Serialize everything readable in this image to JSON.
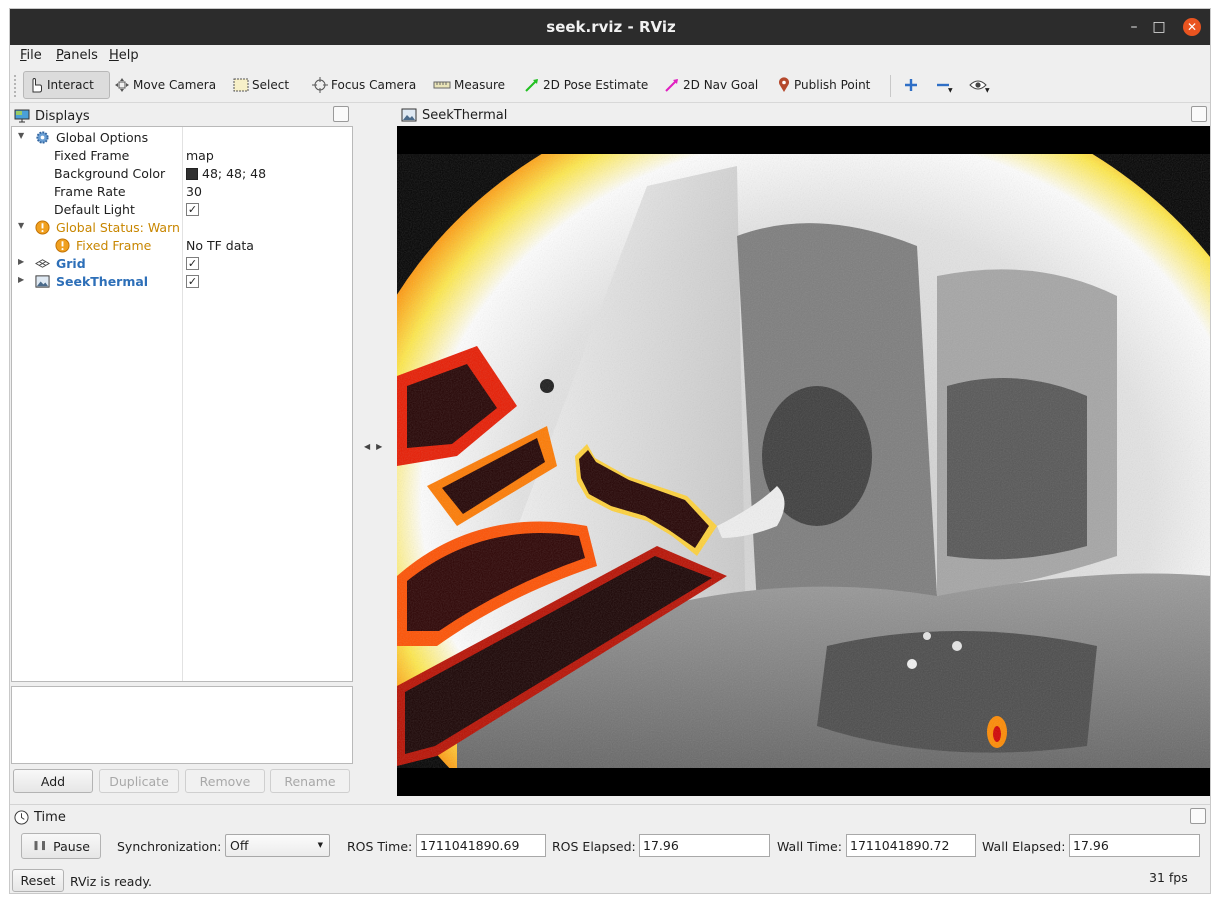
{
  "window": {
    "title": "seek.rviz - RViz"
  },
  "menu": {
    "file": "File",
    "panels": "Panels",
    "help": "Help"
  },
  "toolbar": {
    "interact": "Interact",
    "move_camera": "Move Camera",
    "select": "Select",
    "focus_camera": "Focus Camera",
    "measure": "Measure",
    "pose_estimate": "2D Pose Estimate",
    "nav_goal": "2D Nav Goal",
    "publish_point": "Publish Point"
  },
  "displays": {
    "title": "Displays",
    "global_options": "Global Options",
    "fixed_frame_label": "Fixed Frame",
    "fixed_frame_value": "map",
    "bg_color_label": "Background Color",
    "bg_color_value": "48; 48; 48",
    "bg_color_hex": "#303030",
    "frame_rate_label": "Frame Rate",
    "frame_rate_value": "30",
    "default_light_label": "Default Light",
    "default_light_checked": true,
    "global_status": "Global Status: Warn",
    "status_fixed_frame": "Fixed Frame",
    "status_fixed_frame_value": "No TF data",
    "grid": "Grid",
    "grid_checked": true,
    "seek": "SeekThermal",
    "seek_checked": true,
    "buttons": {
      "add": "Add",
      "duplicate": "Duplicate",
      "remove": "Remove",
      "rename": "Rename"
    }
  },
  "image_panel": {
    "title": "SeekThermal"
  },
  "time": {
    "title": "Time",
    "pause": "Pause",
    "sync_label": "Synchronization:",
    "sync_value": "Off",
    "ros_time_label": "ROS Time:",
    "ros_time": "1711041890.69",
    "ros_elapsed_label": "ROS Elapsed:",
    "ros_elapsed": "17.96",
    "wall_time_label": "Wall Time:",
    "wall_time": "1711041890.72",
    "wall_elapsed_label": "Wall Elapsed:",
    "wall_elapsed": "17.96",
    "reset": "Reset",
    "status": "RViz is ready.",
    "fps": "31 fps"
  },
  "colors": {
    "titlebar": "#2c2c2c",
    "close": "#e95420",
    "warn": "#c88600",
    "link_blue": "#2d6fb8"
  }
}
